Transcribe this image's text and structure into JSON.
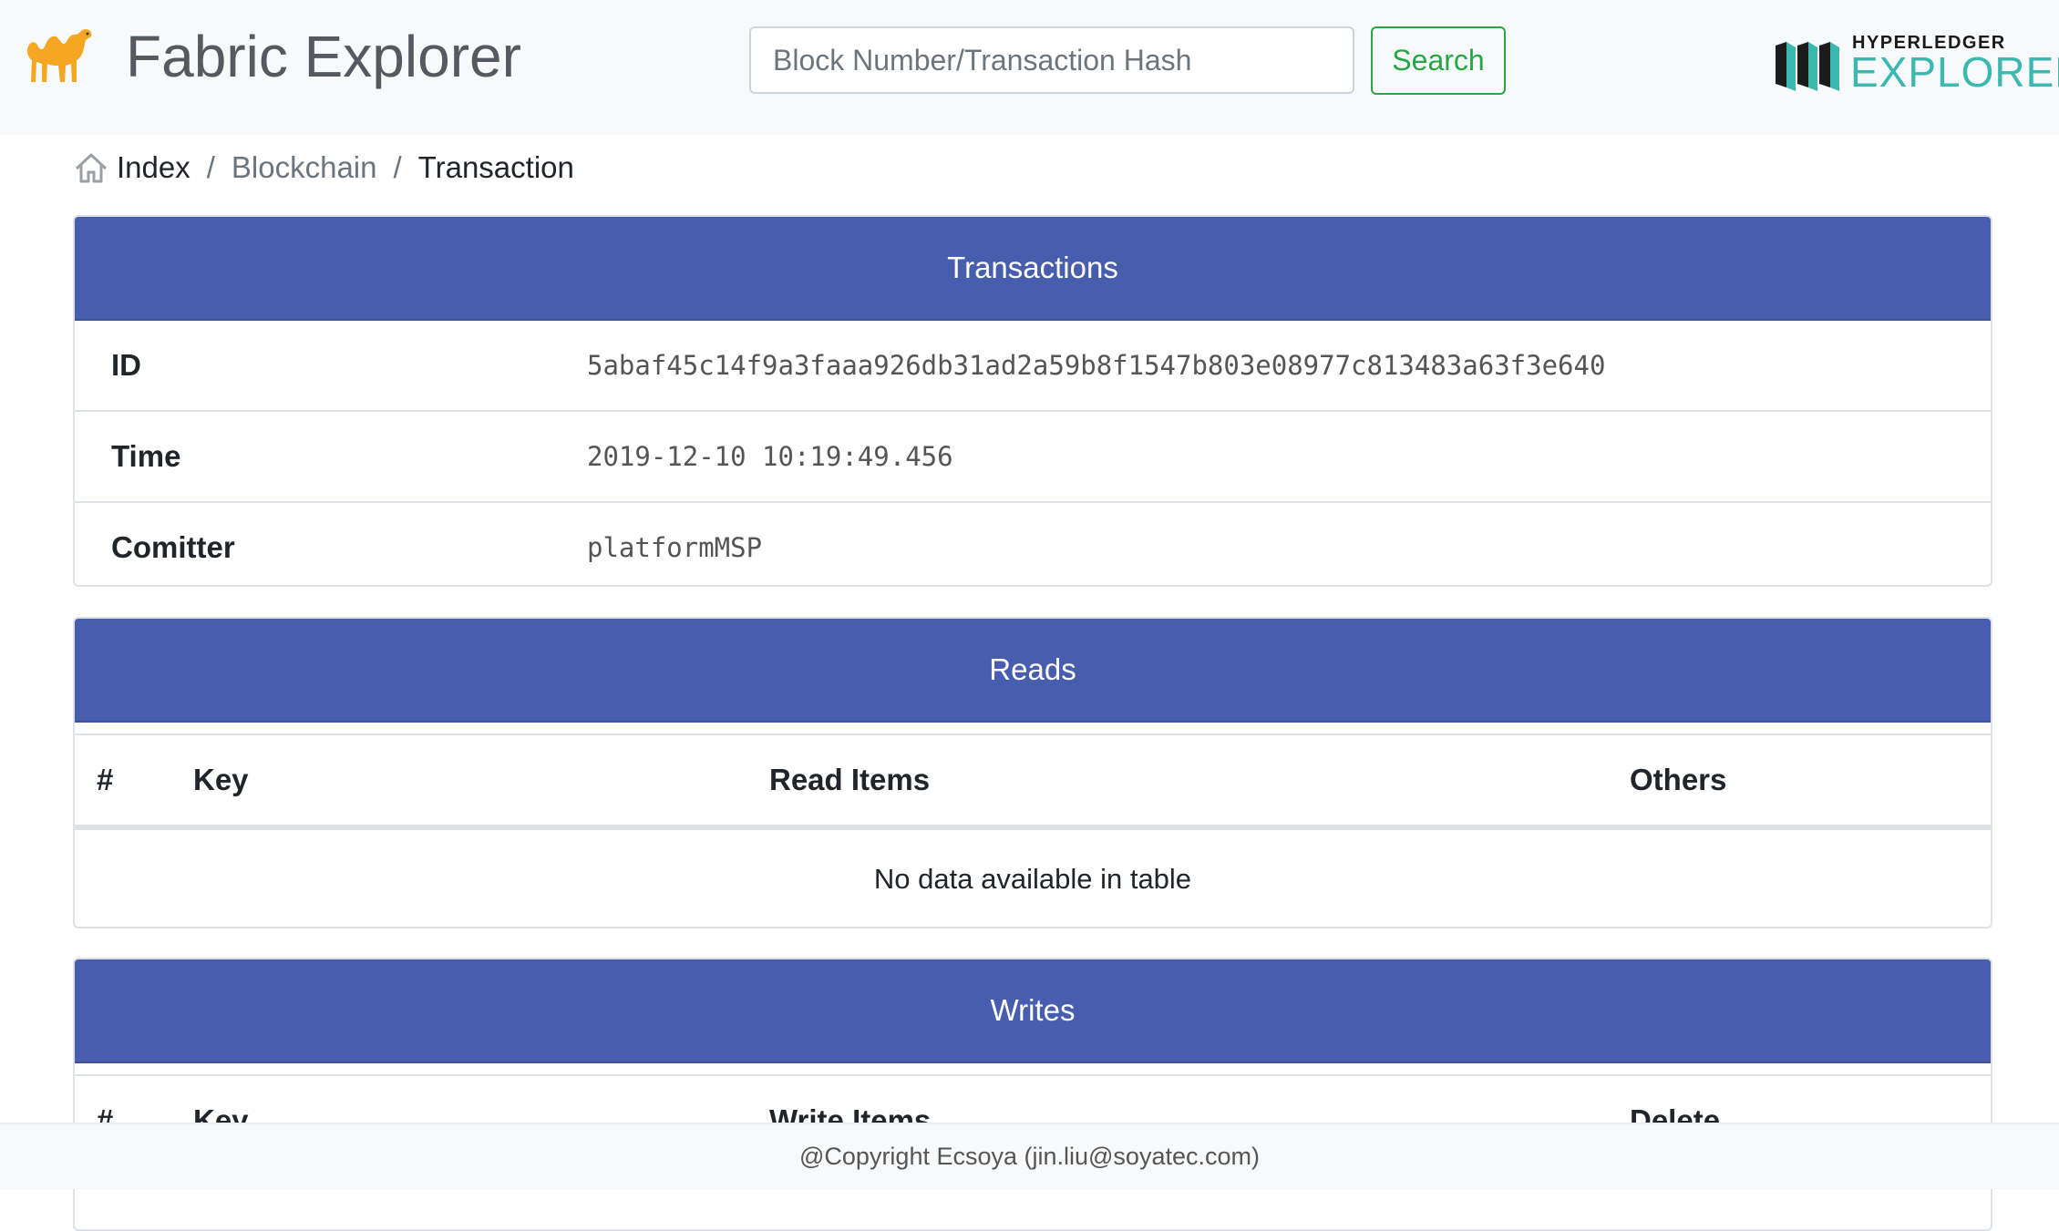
{
  "header": {
    "app_title": "Fabric Explorer",
    "search_placeholder": "Block Number/Transaction Hash",
    "search_button": "Search",
    "logo_top": "HYPERLEDGER",
    "logo_bottom": "EXPLORER"
  },
  "breadcrumb": {
    "items": [
      "Index",
      "Blockchain",
      "Transaction"
    ],
    "separator": "/"
  },
  "transaction_card": {
    "title": "Transactions",
    "rows": [
      {
        "label": "ID",
        "value": "5abaf45c14f9a3faaa926db31ad2a59b8f1547b803e08977c813483a63f3e640"
      },
      {
        "label": "Time",
        "value": "2019-12-10 10:19:49.456"
      },
      {
        "label": "Comitter",
        "value": "platformMSP"
      }
    ]
  },
  "reads_card": {
    "title": "Reads",
    "columns": [
      "#",
      "Key",
      "Read Items",
      "Others"
    ],
    "empty_message": "No data available in table"
  },
  "writes_card": {
    "title": "Writes",
    "columns": [
      "#",
      "Key",
      "Write Items",
      "Delete"
    ]
  },
  "footer": {
    "copyright": "@Copyright Ecsoya (jin.liu@soyatec.com)"
  },
  "colors": {
    "card_header": "#475dad",
    "search_green": "#28a745",
    "logo_teal": "#3bb9b1",
    "camel_orange": "#f5a623"
  },
  "icons": [
    "camel-logo-icon",
    "home-icon",
    "hyperledger-books-icon"
  ]
}
